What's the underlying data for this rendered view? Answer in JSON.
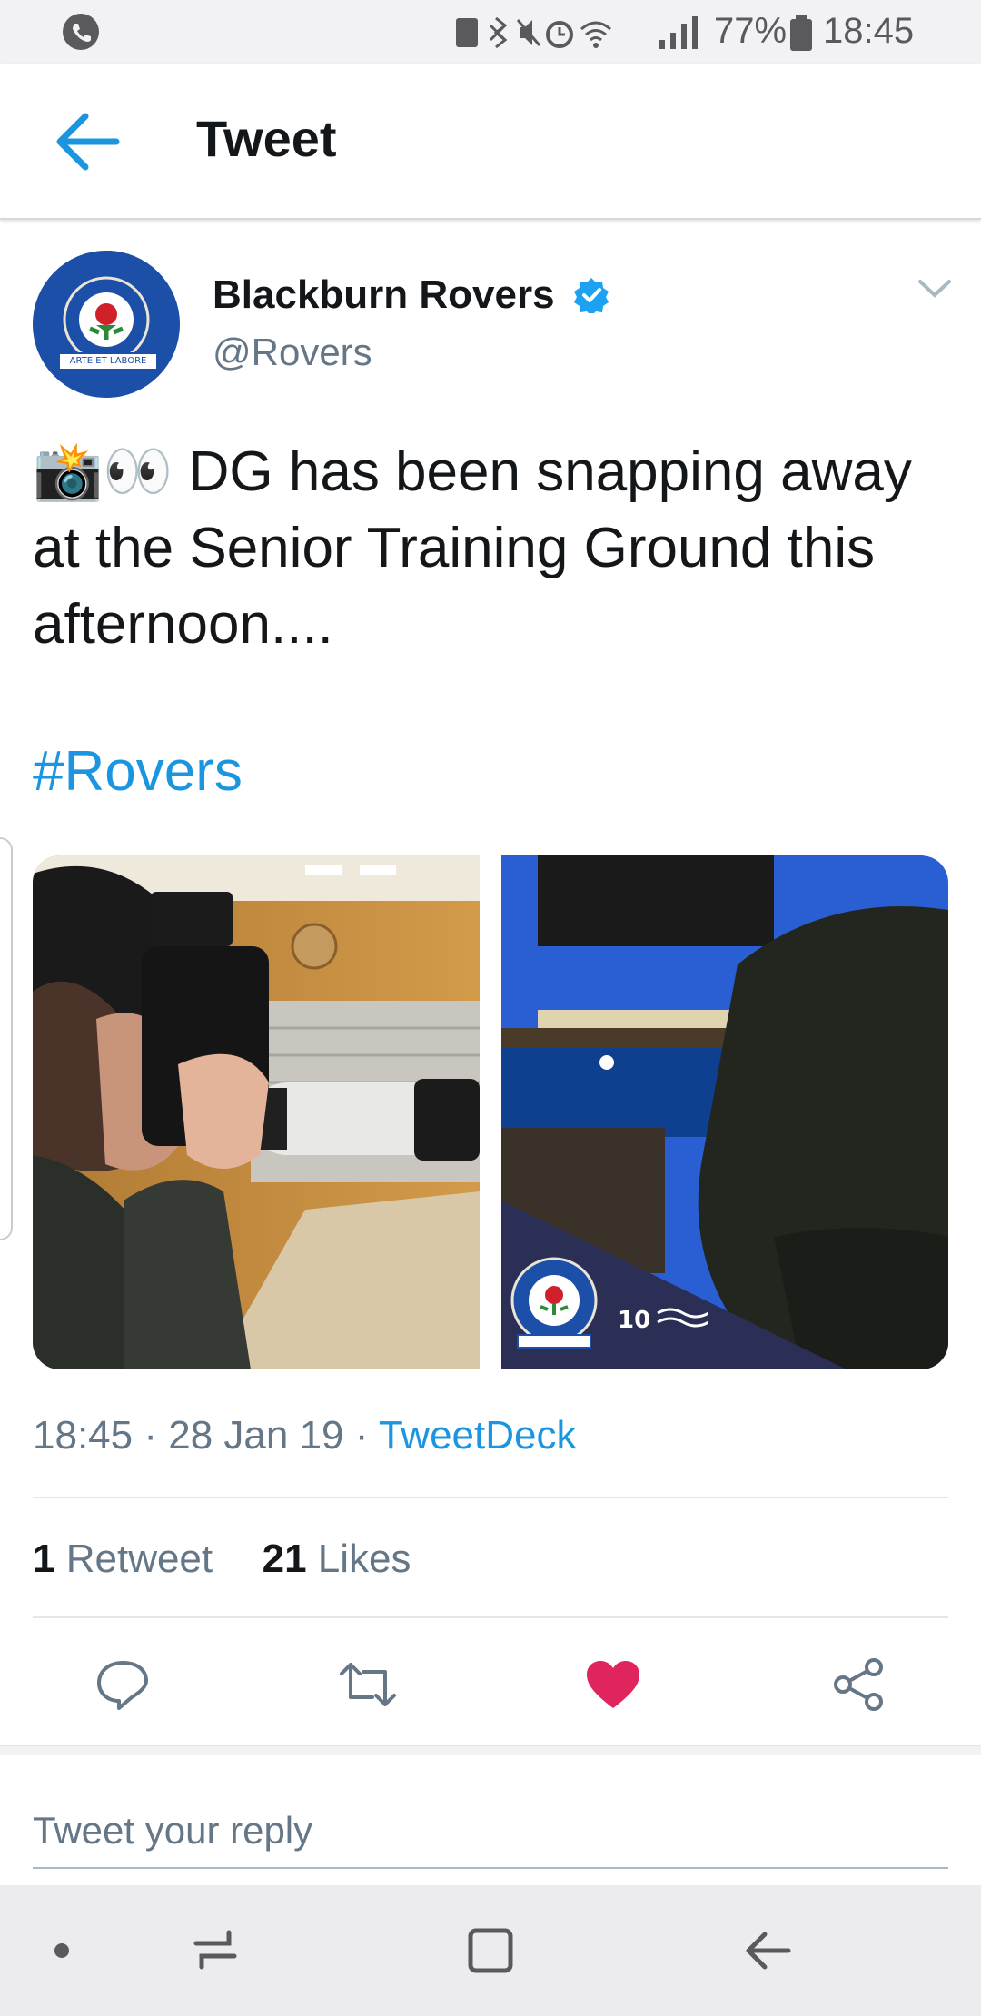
{
  "status_bar": {
    "battery": "77%",
    "time": "18:45"
  },
  "header": {
    "title": "Tweet",
    "back_icon": "arrow-left-icon"
  },
  "tweet": {
    "author_name": "Blackburn Rovers",
    "author_handle": "@Rovers",
    "verified": true,
    "badge_text": "ARTE ET LABORE",
    "emoji": "📸👀",
    "text": "DG has been snapping away at the Senior Training Ground this afternoon....",
    "hashtag": "#Rovers",
    "time": "18:45",
    "date": "28 Jan 19",
    "source": "TweetDeck",
    "retweets_count": "1",
    "retweets_label": "Retweet",
    "likes_count": "21",
    "likes_label": "Likes",
    "liked": true
  },
  "reply": {
    "placeholder": "Tweet your reply"
  },
  "colors": {
    "accent": "#1b95e0",
    "like": "#e0245e",
    "text": "#14171a",
    "muted": "#657786"
  }
}
